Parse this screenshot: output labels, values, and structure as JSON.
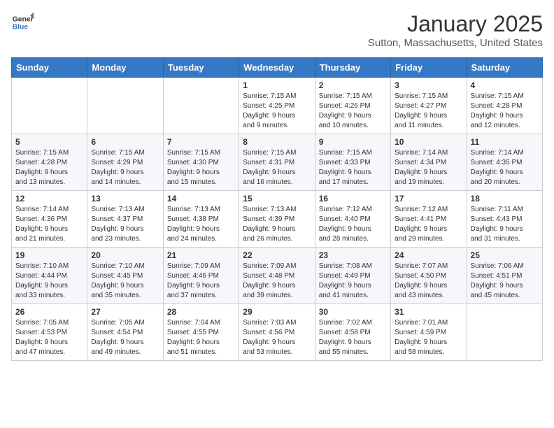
{
  "header": {
    "logo_general": "General",
    "logo_blue": "Blue",
    "month_title": "January 2025",
    "location": "Sutton, Massachusetts, United States"
  },
  "weekdays": [
    "Sunday",
    "Monday",
    "Tuesday",
    "Wednesday",
    "Thursday",
    "Friday",
    "Saturday"
  ],
  "weeks": [
    [
      {
        "day": "",
        "info": ""
      },
      {
        "day": "",
        "info": ""
      },
      {
        "day": "",
        "info": ""
      },
      {
        "day": "1",
        "info": "Sunrise: 7:15 AM\nSunset: 4:25 PM\nDaylight: 9 hours\nand 9 minutes."
      },
      {
        "day": "2",
        "info": "Sunrise: 7:15 AM\nSunset: 4:26 PM\nDaylight: 9 hours\nand 10 minutes."
      },
      {
        "day": "3",
        "info": "Sunrise: 7:15 AM\nSunset: 4:27 PM\nDaylight: 9 hours\nand 11 minutes."
      },
      {
        "day": "4",
        "info": "Sunrise: 7:15 AM\nSunset: 4:28 PM\nDaylight: 9 hours\nand 12 minutes."
      }
    ],
    [
      {
        "day": "5",
        "info": "Sunrise: 7:15 AM\nSunset: 4:28 PM\nDaylight: 9 hours\nand 13 minutes."
      },
      {
        "day": "6",
        "info": "Sunrise: 7:15 AM\nSunset: 4:29 PM\nDaylight: 9 hours\nand 14 minutes."
      },
      {
        "day": "7",
        "info": "Sunrise: 7:15 AM\nSunset: 4:30 PM\nDaylight: 9 hours\nand 15 minutes."
      },
      {
        "day": "8",
        "info": "Sunrise: 7:15 AM\nSunset: 4:31 PM\nDaylight: 9 hours\nand 16 minutes."
      },
      {
        "day": "9",
        "info": "Sunrise: 7:15 AM\nSunset: 4:33 PM\nDaylight: 9 hours\nand 17 minutes."
      },
      {
        "day": "10",
        "info": "Sunrise: 7:14 AM\nSunset: 4:34 PM\nDaylight: 9 hours\nand 19 minutes."
      },
      {
        "day": "11",
        "info": "Sunrise: 7:14 AM\nSunset: 4:35 PM\nDaylight: 9 hours\nand 20 minutes."
      }
    ],
    [
      {
        "day": "12",
        "info": "Sunrise: 7:14 AM\nSunset: 4:36 PM\nDaylight: 9 hours\nand 21 minutes."
      },
      {
        "day": "13",
        "info": "Sunrise: 7:13 AM\nSunset: 4:37 PM\nDaylight: 9 hours\nand 23 minutes."
      },
      {
        "day": "14",
        "info": "Sunrise: 7:13 AM\nSunset: 4:38 PM\nDaylight: 9 hours\nand 24 minutes."
      },
      {
        "day": "15",
        "info": "Sunrise: 7:13 AM\nSunset: 4:39 PM\nDaylight: 9 hours\nand 26 minutes."
      },
      {
        "day": "16",
        "info": "Sunrise: 7:12 AM\nSunset: 4:40 PM\nDaylight: 9 hours\nand 28 minutes."
      },
      {
        "day": "17",
        "info": "Sunrise: 7:12 AM\nSunset: 4:41 PM\nDaylight: 9 hours\nand 29 minutes."
      },
      {
        "day": "18",
        "info": "Sunrise: 7:11 AM\nSunset: 4:43 PM\nDaylight: 9 hours\nand 31 minutes."
      }
    ],
    [
      {
        "day": "19",
        "info": "Sunrise: 7:10 AM\nSunset: 4:44 PM\nDaylight: 9 hours\nand 33 minutes."
      },
      {
        "day": "20",
        "info": "Sunrise: 7:10 AM\nSunset: 4:45 PM\nDaylight: 9 hours\nand 35 minutes."
      },
      {
        "day": "21",
        "info": "Sunrise: 7:09 AM\nSunset: 4:46 PM\nDaylight: 9 hours\nand 37 minutes."
      },
      {
        "day": "22",
        "info": "Sunrise: 7:09 AM\nSunset: 4:48 PM\nDaylight: 9 hours\nand 39 minutes."
      },
      {
        "day": "23",
        "info": "Sunrise: 7:08 AM\nSunset: 4:49 PM\nDaylight: 9 hours\nand 41 minutes."
      },
      {
        "day": "24",
        "info": "Sunrise: 7:07 AM\nSunset: 4:50 PM\nDaylight: 9 hours\nand 43 minutes."
      },
      {
        "day": "25",
        "info": "Sunrise: 7:06 AM\nSunset: 4:51 PM\nDaylight: 9 hours\nand 45 minutes."
      }
    ],
    [
      {
        "day": "26",
        "info": "Sunrise: 7:05 AM\nSunset: 4:53 PM\nDaylight: 9 hours\nand 47 minutes."
      },
      {
        "day": "27",
        "info": "Sunrise: 7:05 AM\nSunset: 4:54 PM\nDaylight: 9 hours\nand 49 minutes."
      },
      {
        "day": "28",
        "info": "Sunrise: 7:04 AM\nSunset: 4:55 PM\nDaylight: 9 hours\nand 51 minutes."
      },
      {
        "day": "29",
        "info": "Sunrise: 7:03 AM\nSunset: 4:56 PM\nDaylight: 9 hours\nand 53 minutes."
      },
      {
        "day": "30",
        "info": "Sunrise: 7:02 AM\nSunset: 4:58 PM\nDaylight: 9 hours\nand 55 minutes."
      },
      {
        "day": "31",
        "info": "Sunrise: 7:01 AM\nSunset: 4:59 PM\nDaylight: 9 hours\nand 58 minutes."
      },
      {
        "day": "",
        "info": ""
      }
    ]
  ]
}
